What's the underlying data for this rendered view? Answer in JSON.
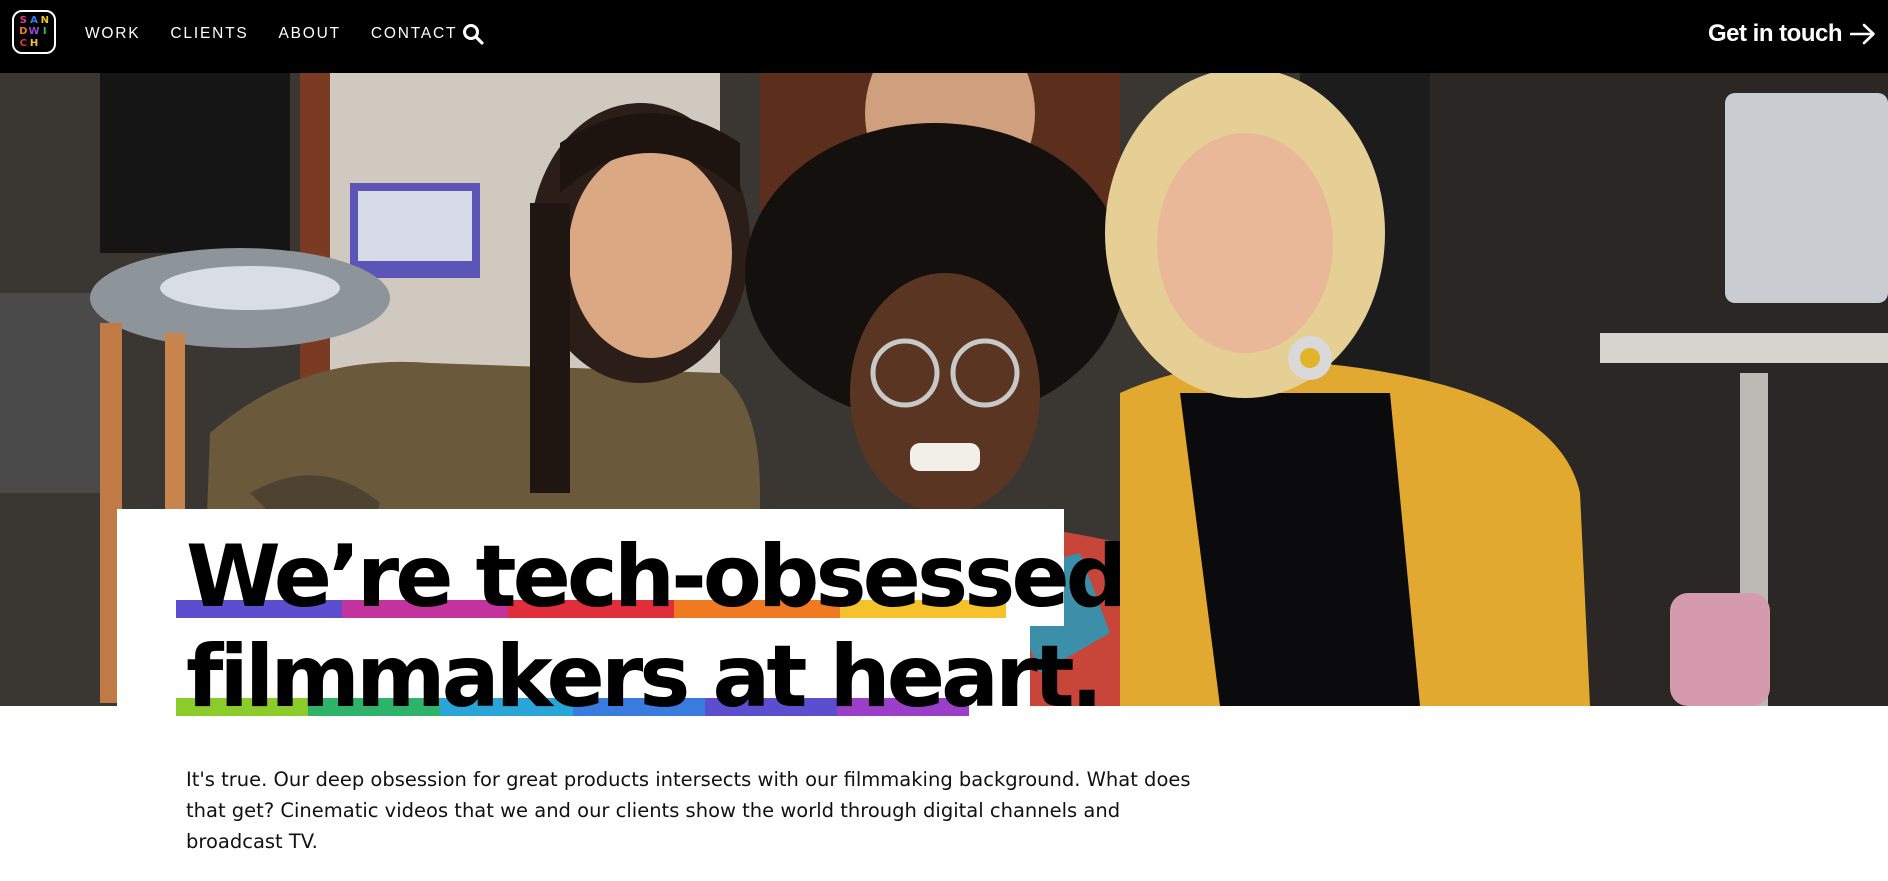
{
  "brand": {
    "logo_letters": [
      "S",
      "A",
      "N",
      "D",
      "W",
      "I",
      "C",
      "H",
      ""
    ],
    "logo_colors": [
      "#e83a8c",
      "#2d7ef7",
      "#f6c324",
      "#f07a22",
      "#8e4cd8",
      "#35b86b",
      "#d93a3a",
      "#f6c324",
      "#2d7ef7"
    ]
  },
  "nav": {
    "items": [
      {
        "label": "WORK"
      },
      {
        "label": "CLIENTS"
      },
      {
        "label": "ABOUT"
      },
      {
        "label": "CONTACT"
      }
    ],
    "search_icon": "search-icon",
    "cta_label": "Get in touch",
    "cta_icon": "arrow-right-icon"
  },
  "hero": {
    "headline_line1": "We’re tech-obsessed",
    "headline_line2": "filmmakers at heart.",
    "underline_colors_line1": [
      "#5b4fcf",
      "#c3339e",
      "#e02f3a",
      "#f07a22",
      "#f5c22a"
    ],
    "underline_colors_line2": [
      "#8ccc2a",
      "#2fb36b",
      "#2aa5d8",
      "#3a7be0",
      "#5b4fcf",
      "#9b3fc9"
    ]
  },
  "intro": {
    "text": "It's true. Our deep obsession for great products intersects with our filmmaking background. What does that get? Cinematic videos that we and our clients show the world through digital channels and broadcast TV."
  }
}
